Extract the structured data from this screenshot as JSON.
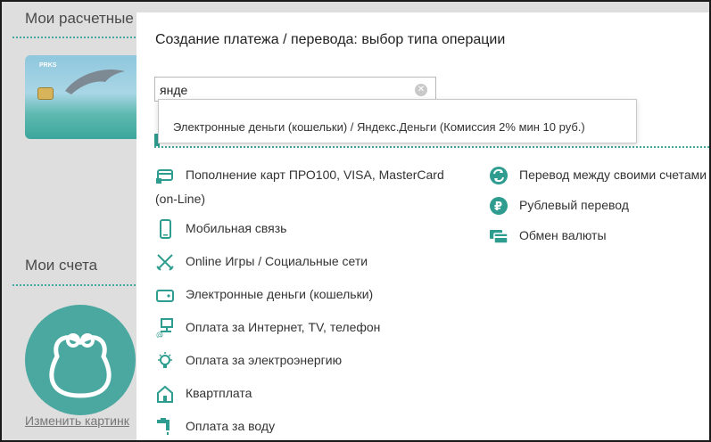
{
  "background": {
    "heading_cards": "Мои расчетные",
    "heading_accounts": "Мои счета",
    "change_picture_link": "Изменить картинк"
  },
  "modal": {
    "title": "Создание платежа / перевода: выбор типа операции",
    "search": {
      "value": "янде",
      "clear_icon": "clear-icon"
    },
    "suggestion": "Электронные деньги (кошельки) / Яндекс.Деньги (Комиссия 2% мин 10 руб.)",
    "left_operations": [
      {
        "label": "Пополнение карт ПРО100, VISA, MasterCard",
        "label2": "(on-Line)",
        "icon": "card-icon"
      },
      {
        "label": "Мобильная связь",
        "icon": "mobile-phone-icon"
      },
      {
        "label": "Online Игры / Социальные сети",
        "icon": "crossed-swords-icon"
      },
      {
        "label": "Электронные деньги (кошельки)",
        "icon": "wallet-icon"
      },
      {
        "label": "Оплата за Интернет, TV, телефон",
        "icon": "network-icon"
      },
      {
        "label": "Оплата за электроэнергию",
        "icon": "lightbulb-icon"
      },
      {
        "label": "Квартплата",
        "icon": "house-icon"
      },
      {
        "label": "Оплата за воду",
        "icon": "faucet-icon"
      }
    ],
    "right_operations": [
      {
        "label": "Перевод между своими счетами",
        "icon": "transfer-arrows-icon"
      },
      {
        "label": "Рублевый перевод",
        "icon": "ruble-icon"
      },
      {
        "label": "Обмен валюты",
        "icon": "currency-exchange-icon"
      }
    ]
  },
  "colors": {
    "accent": "#2e9d8f",
    "text": "#333333",
    "overlay": "#dedede"
  }
}
